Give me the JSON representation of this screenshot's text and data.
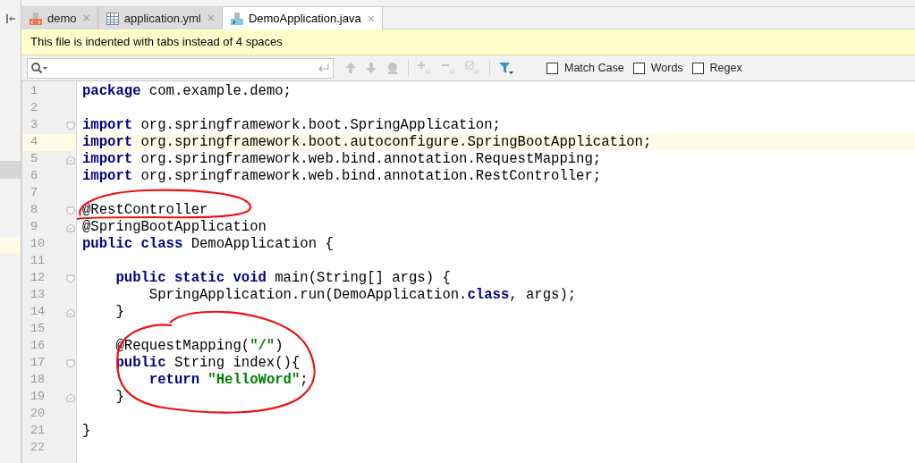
{
  "tabs": [
    {
      "label": "demo",
      "kind": "module",
      "selected": false,
      "close": "×"
    },
    {
      "label": "application.yml",
      "kind": "yaml",
      "selected": false,
      "close": "×"
    },
    {
      "label": "DemoApplication.java",
      "kind": "java",
      "selected": true,
      "close": "×"
    }
  ],
  "banner": "This file is indented with tabs instead of 4 spaces",
  "search": {
    "options": [
      {
        "label": "Match Case",
        "checked": false
      },
      {
        "label": "Words",
        "checked": false
      },
      {
        "label": "Regex",
        "checked": false
      }
    ]
  },
  "lines": [
    {
      "number": "1",
      "current": false,
      "kind": "plain",
      "tokens": [
        {
          "kind": "keyword",
          "text": "package"
        },
        {
          "kind": "plain",
          "text": " com.example.demo;"
        }
      ]
    },
    {
      "number": "2",
      "current": false,
      "kind": "plain"
    },
    {
      "number": "3",
      "current": false,
      "kind": "fold-start",
      "tokens": [
        {
          "kind": "keyword",
          "text": "import"
        },
        {
          "kind": "plain",
          "text": " org.springframework.boot.SpringApplication;"
        }
      ]
    },
    {
      "number": "4",
      "current": true,
      "kind": "plain",
      "tokens": [
        {
          "kind": "keyword",
          "text": "import"
        },
        {
          "kind": "plain",
          "text": " org.springframework.boot.autoconfigure.SpringBootApplication;"
        }
      ]
    },
    {
      "number": "5",
      "current": false,
      "kind": "fold-end",
      "tokens": [
        {
          "kind": "keyword",
          "text": "import"
        },
        {
          "kind": "plain",
          "text": " org.springframework.web.bind.annotation.RequestMapping;"
        }
      ]
    },
    {
      "number": "6",
      "current": false,
      "kind": "plain",
      "tokens": [
        {
          "kind": "keyword",
          "text": "import"
        },
        {
          "kind": "plain",
          "text": " org.springframework.web.bind.annotation.RestController;"
        }
      ]
    },
    {
      "number": "7",
      "current": false,
      "kind": "plain"
    },
    {
      "number": "8",
      "current": false,
      "kind": "fold-start",
      "tokens": [
        {
          "kind": "plain",
          "text": "@RestController"
        }
      ]
    },
    {
      "number": "9",
      "current": false,
      "kind": "fold-end",
      "tokens": [
        {
          "kind": "plain",
          "text": "@SpringBootApplication"
        }
      ]
    },
    {
      "number": "10",
      "current": false,
      "kind": "plain",
      "tokens": [
        {
          "kind": "keyword",
          "text": "public class"
        },
        {
          "kind": "plain",
          "text": " DemoApplication {"
        }
      ]
    },
    {
      "number": "11",
      "current": false,
      "kind": "plain"
    },
    {
      "number": "12",
      "current": false,
      "kind": "fold-start",
      "tokens": [
        {
          "kind": "keyword",
          "text": "    public static void"
        },
        {
          "kind": "plain",
          "text": " main(String[] args) {"
        }
      ]
    },
    {
      "number": "13",
      "current": false,
      "kind": "plain",
      "tokens": [
        {
          "kind": "plain",
          "text": "        SpringApplication.run(DemoApplication."
        },
        {
          "kind": "keyword",
          "text": "class"
        },
        {
          "kind": "plain",
          "text": ", args);"
        }
      ]
    },
    {
      "number": "14",
      "current": false,
      "kind": "fold-end",
      "tokens": [
        {
          "kind": "plain",
          "text": "    }"
        }
      ]
    },
    {
      "number": "15",
      "current": false,
      "kind": "plain"
    },
    {
      "number": "16",
      "current": false,
      "kind": "plain",
      "tokens": [
        {
          "kind": "plain",
          "text": "    @RequestMapping("
        },
        {
          "kind": "string",
          "text": "\"/\""
        },
        {
          "kind": "plain",
          "text": ")"
        }
      ]
    },
    {
      "number": "17",
      "current": false,
      "kind": "fold-start",
      "tokens": [
        {
          "kind": "keyword",
          "text": "    public"
        },
        {
          "kind": "plain",
          "text": " String index(){"
        }
      ]
    },
    {
      "number": "18",
      "current": false,
      "kind": "plain",
      "tokens": [
        {
          "kind": "keyword",
          "text": "        return"
        },
        {
          "kind": "string",
          "text": " \"HelloWord\""
        },
        {
          "kind": "plain",
          "text": ";"
        }
      ]
    },
    {
      "number": "19",
      "current": false,
      "kind": "fold-end",
      "tokens": [
        {
          "kind": "plain",
          "text": "    }"
        }
      ]
    },
    {
      "number": "20",
      "current": false,
      "kind": "plain"
    },
    {
      "number": "21",
      "current": false,
      "kind": "plain",
      "tokens": [
        {
          "kind": "plain",
          "text": "}"
        }
      ]
    },
    {
      "number": "22",
      "current": false,
      "kind": "plain"
    }
  ]
}
